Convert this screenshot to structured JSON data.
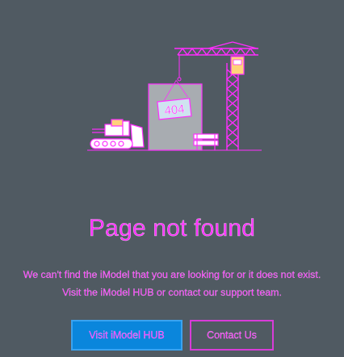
{
  "illustration": {
    "icon": "under-construction-404-icon",
    "sign_text": "404",
    "colors": {
      "accent": "#ff2dff",
      "building": "#a8acb1",
      "sign": "#cfe3f0",
      "crane_cab": "#ffd37a"
    }
  },
  "main": {
    "title": "Page not found",
    "message_line1": "We can't find the iModel that you are looking for or it does not exist.",
    "message_line2": "Visit the iModel HUB or contact our support team."
  },
  "actions": {
    "primary_label": "Visit iModel HUB",
    "secondary_label": "Contact Us"
  },
  "colors": {
    "background": "#505a62",
    "text": "#ff2dff",
    "primary_button": "#0a86dc"
  }
}
